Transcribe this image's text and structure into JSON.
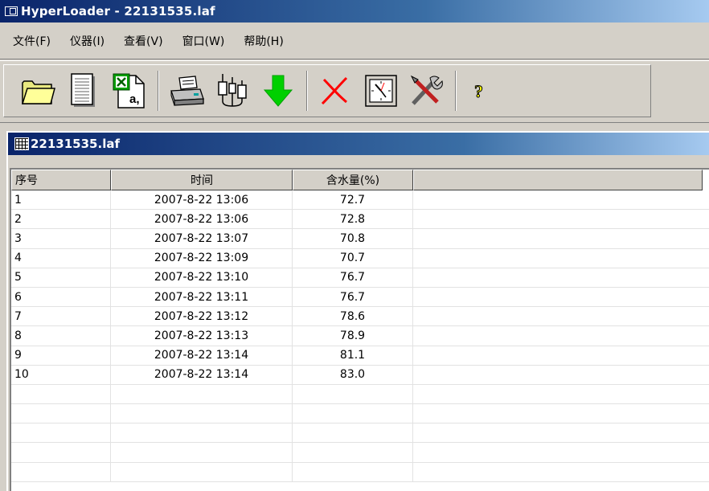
{
  "window": {
    "title": "HyperLoader - 22131535.laf"
  },
  "menu": [
    {
      "id": "file",
      "label": "文件(F)"
    },
    {
      "id": "instrument",
      "label": "仪器(I)"
    },
    {
      "id": "view",
      "label": "查看(V)"
    },
    {
      "id": "window",
      "label": "窗口(W)"
    },
    {
      "id": "help",
      "label": "帮助(H)"
    }
  ],
  "toolbar": {
    "buttons": [
      {
        "name": "open-folder-icon"
      },
      {
        "name": "document-icon"
      },
      {
        "name": "excel-export-icon"
      },
      {
        "name": "print-icon"
      },
      {
        "name": "connect-instrument-icon"
      },
      {
        "name": "download-arrow-icon"
      },
      {
        "name": "delete-x-icon"
      },
      {
        "name": "clock-icon"
      },
      {
        "name": "tools-icon"
      },
      {
        "name": "help-question-icon"
      }
    ],
    "colors": {
      "arrow": "#00d000",
      "delete": "#ff0000",
      "folder": "#ffff99"
    }
  },
  "document": {
    "title": "22131535.laf"
  },
  "table": {
    "headers": [
      "序号",
      "时间",
      "含水量(%)"
    ],
    "rows": [
      [
        "1",
        "2007-8-22 13:06",
        "72.7"
      ],
      [
        "2",
        "2007-8-22 13:06",
        "72.8"
      ],
      [
        "3",
        "2007-8-22 13:07",
        "70.8"
      ],
      [
        "4",
        "2007-8-22 13:09",
        "70.7"
      ],
      [
        "5",
        "2007-8-22 13:10",
        "76.7"
      ],
      [
        "6",
        "2007-8-22 13:11",
        "76.7"
      ],
      [
        "7",
        "2007-8-22 13:12",
        "78.6"
      ],
      [
        "8",
        "2007-8-22 13:13",
        "78.9"
      ],
      [
        "9",
        "2007-8-22 13:14",
        "81.1"
      ],
      [
        "10",
        "2007-8-22 13:14",
        "83.0"
      ]
    ],
    "empty_rows": 5
  }
}
